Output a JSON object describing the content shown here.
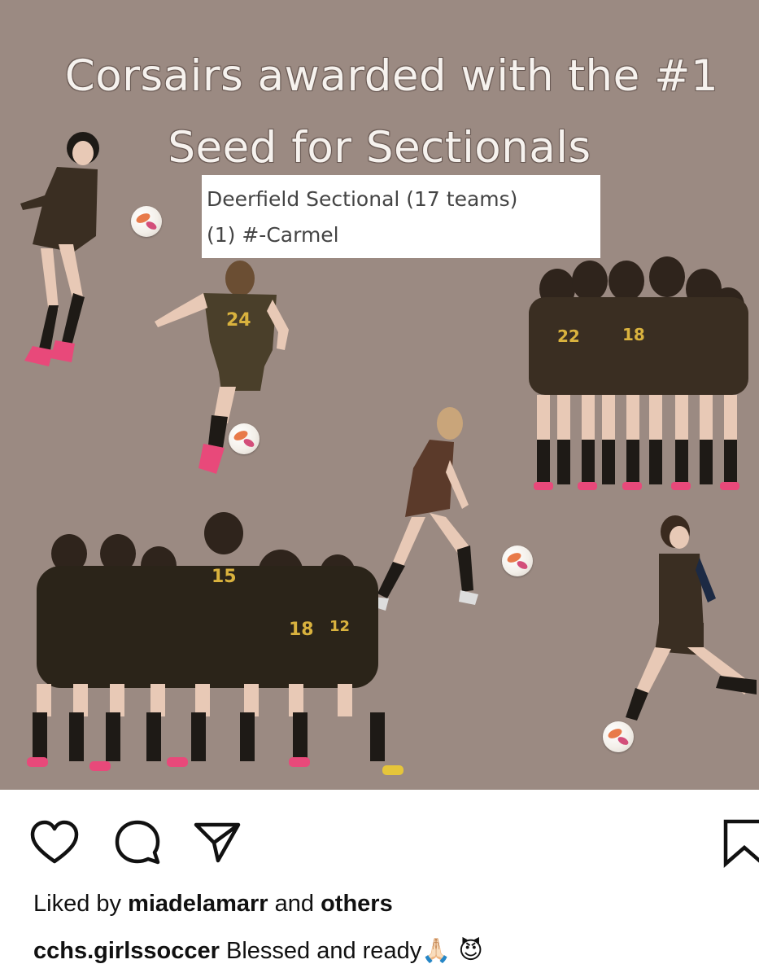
{
  "post": {
    "image": {
      "title_line1": "Corsairs awarded with the #1",
      "title_line2": "Seed for Sectionals",
      "seed_box": {
        "line1": "Deerfield Sectional (17 teams)",
        "line2": "(1) #-Carmel"
      },
      "jersey_numbers": [
        "24",
        "22",
        "18",
        "15",
        "18",
        "12"
      ],
      "background_color": "#9b8a82"
    },
    "actions": {
      "like_icon": "heart-icon",
      "comment_icon": "comment-bubble-icon",
      "share_icon": "paper-plane-icon",
      "save_icon": "bookmark-icon"
    },
    "likes": {
      "prefix": "Liked by",
      "user": "miadelamarr",
      "connector": "and",
      "others": "others"
    },
    "caption": {
      "username": "cchs.girlssoccer",
      "text": "Blessed and ready",
      "emojis": "🙏🏻 😈"
    }
  }
}
